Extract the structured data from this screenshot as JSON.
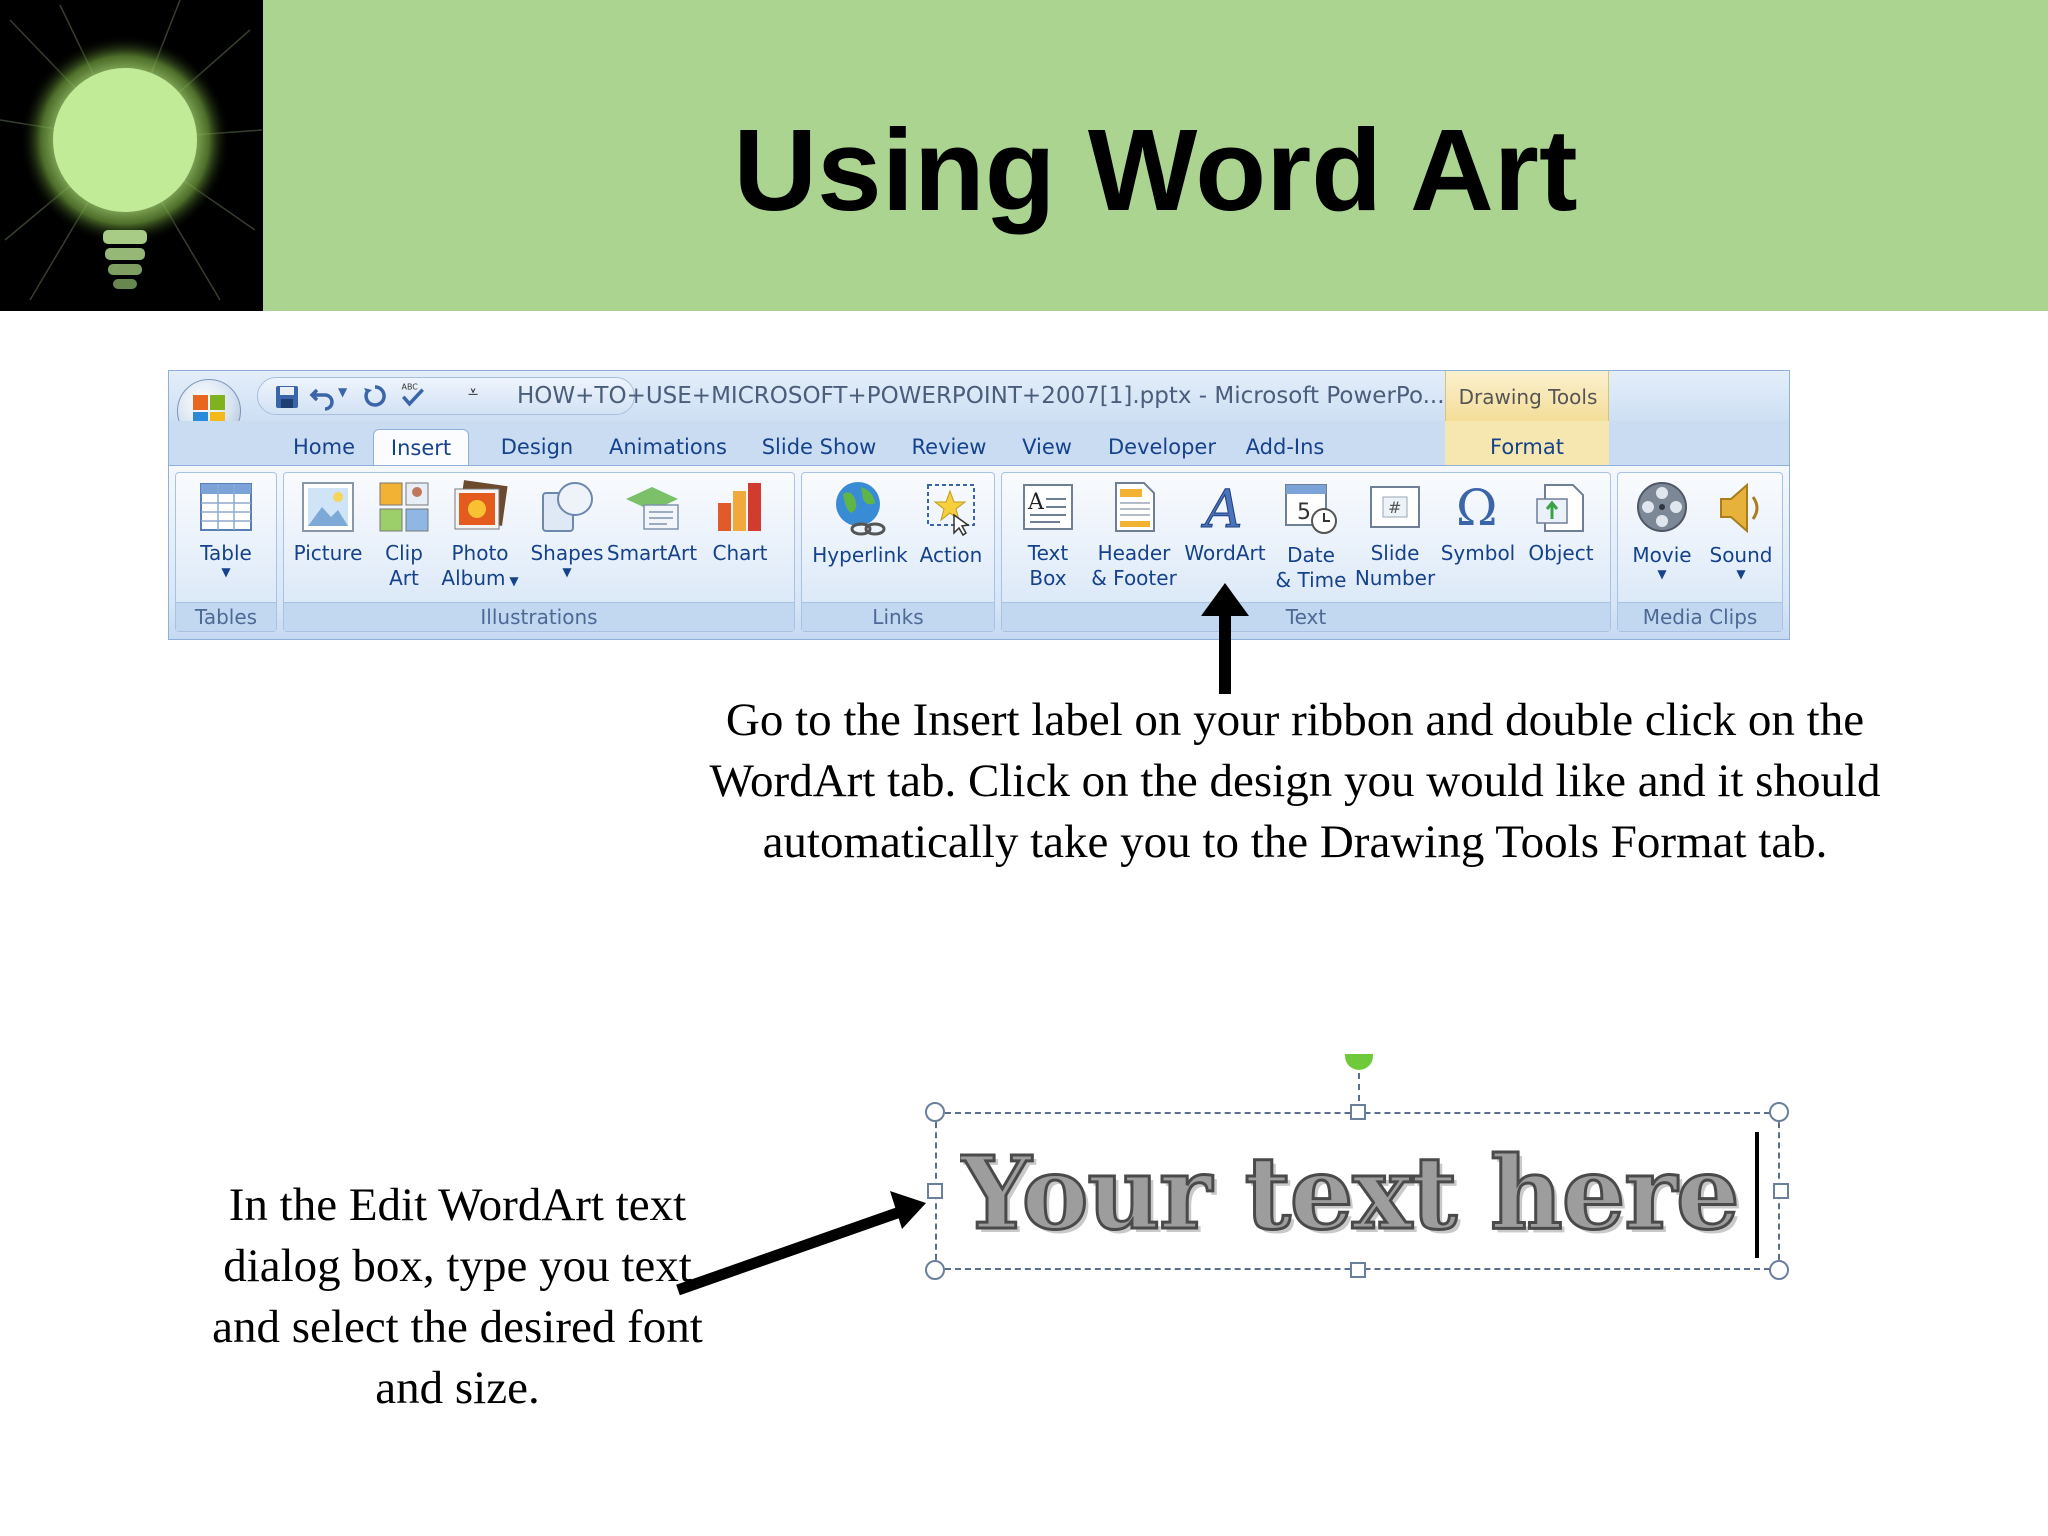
{
  "slide": {
    "title": "Using Word Art",
    "header_color": "#acd491"
  },
  "ribbon": {
    "window_title": "HOW+TO+USE+MICROSOFT+POWERPOINT+2007[1].pptx - Microsoft PowerPo...",
    "contextual_tab_label": "Drawing Tools",
    "tabs": [
      {
        "label": "Home"
      },
      {
        "label": "Insert"
      },
      {
        "label": "Design"
      },
      {
        "label": "Animations"
      },
      {
        "label": "Slide Show"
      },
      {
        "label": "Review"
      },
      {
        "label": "View"
      },
      {
        "label": "Developer"
      },
      {
        "label": "Add-Ins"
      },
      {
        "label": "Format"
      }
    ],
    "active_tab": "Insert",
    "groups": {
      "tables": {
        "label": "Tables",
        "commands": {
          "table": {
            "line1": "Table"
          }
        }
      },
      "illustrations": {
        "label": "Illustrations",
        "commands": {
          "picture": {
            "line1": "Picture"
          },
          "clip_art": {
            "line1": "Clip",
            "line2": "Art"
          },
          "photo_album": {
            "line1": "Photo",
            "line2": "Album"
          },
          "shapes": {
            "line1": "Shapes"
          },
          "smartart": {
            "line1": "SmartArt"
          },
          "chart": {
            "line1": "Chart"
          }
        }
      },
      "links": {
        "label": "Links",
        "commands": {
          "hyperlink": {
            "line1": "Hyperlink"
          },
          "action": {
            "line1": "Action"
          }
        }
      },
      "text": {
        "label": "Text",
        "commands": {
          "text_box": {
            "line1": "Text",
            "line2": "Box"
          },
          "header_footer": {
            "line1": "Header",
            "line2": "& Footer"
          },
          "wordart": {
            "line1": "WordArt"
          },
          "date_time": {
            "line1": "Date",
            "line2": "& Time"
          },
          "slide_number": {
            "line1": "Slide",
            "line2": "Number"
          },
          "symbol": {
            "line1": "Symbol"
          },
          "object": {
            "line1": "Object"
          }
        }
      },
      "media_clips": {
        "label": "Media Clips",
        "commands": {
          "movie": {
            "line1": "Movie"
          },
          "sound": {
            "line1": "Sound"
          }
        }
      }
    }
  },
  "instructions": {
    "top": "Go to the Insert label on your ribbon and double click on the WordArt tab. Click on the design you would like and it should automatically take you to the Drawing Tools Format tab.",
    "bottom": "In the Edit WordArt text  dialog box, type you text and select the desired font and size."
  },
  "wordart_sample": {
    "text": "Your text here",
    "rotate_handle_color": "#6fca3b"
  }
}
